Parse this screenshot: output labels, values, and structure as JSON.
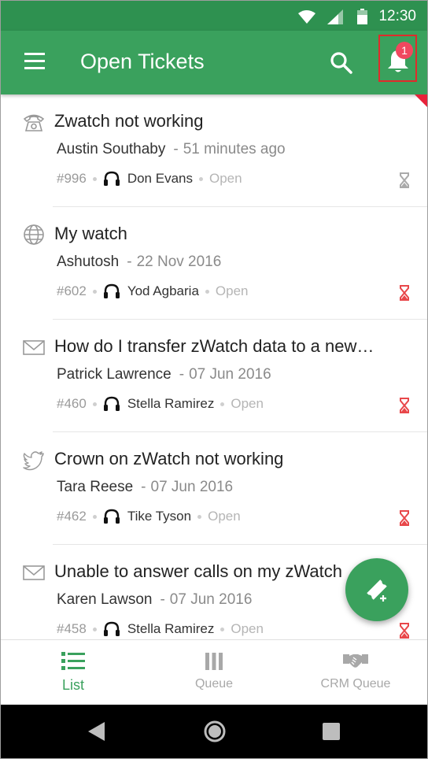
{
  "status_bar": {
    "time": "12:30"
  },
  "app_bar": {
    "title": "Open Tickets",
    "notification_count": "1"
  },
  "tickets": [
    {
      "channel_icon": "phone-icon",
      "subject": "Zwatch not working",
      "contact": "Austin Southaby",
      "time": "51 minutes ago",
      "number": "#996",
      "agent": "Don Evans",
      "status": "Open",
      "overdue": false
    },
    {
      "channel_icon": "globe-icon",
      "subject": "My watch",
      "contact": "Ashutosh",
      "time": "22 Nov 2016",
      "number": "#602",
      "agent": "Yod Agbaria",
      "status": "Open",
      "overdue": true
    },
    {
      "channel_icon": "mail-icon",
      "subject": "How do I transfer zWatch data to a new…",
      "contact": "Patrick Lawrence",
      "time": "07 Jun 2016",
      "number": "#460",
      "agent": "Stella Ramirez",
      "status": "Open",
      "overdue": true
    },
    {
      "channel_icon": "twitter-icon",
      "subject": "Crown on zWatch not working",
      "contact": "Tara Reese",
      "time": "07 Jun 2016",
      "number": "#462",
      "agent": "Tike Tyson",
      "status": "Open",
      "overdue": true
    },
    {
      "channel_icon": "mail-icon",
      "subject": "Unable to answer calls on my zWatch",
      "contact": "Karen Lawson",
      "time": "07 Jun 2016",
      "number": "#458",
      "agent": "Stella Ramirez",
      "status": "Open",
      "overdue": true
    }
  ],
  "bottom_nav": [
    {
      "label": "List",
      "icon": "list-icon",
      "active": true
    },
    {
      "label": "Queue",
      "icon": "queue-icon",
      "active": false
    },
    {
      "label": "CRM Queue",
      "icon": "handshake-icon",
      "active": false
    }
  ],
  "colors": {
    "primary": "#3aa15d",
    "status_bar": "#2e9150",
    "overdue": "#e8474a",
    "badge": "#f0485f"
  }
}
